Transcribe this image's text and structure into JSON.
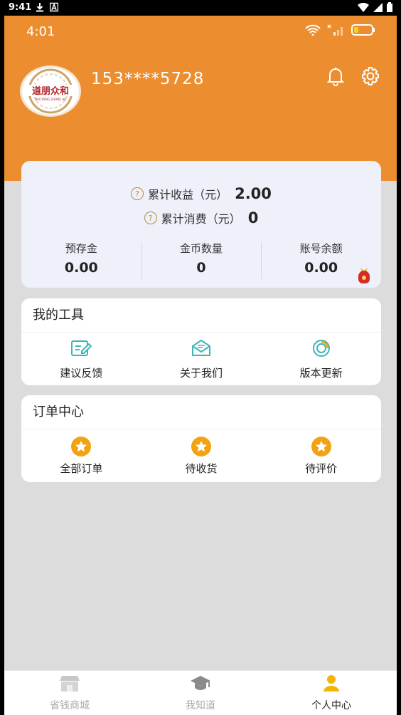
{
  "system": {
    "time": "9:41"
  },
  "inner_status": {
    "time": "4:01"
  },
  "profile": {
    "phone": "153****5728",
    "avatar_text": "道朋众和",
    "avatar_subtext": "DAO PENG ZHONG HE"
  },
  "stats": {
    "earnings_label": "累计收益（元）",
    "earnings_value": "2.00",
    "spending_label": "累计消费（元）",
    "spending_value": "0",
    "columns": [
      {
        "label": "预存金",
        "value": "0.00"
      },
      {
        "label": "金币数量",
        "value": "0"
      },
      {
        "label": "账号余额",
        "value": "0.00"
      }
    ]
  },
  "tools": {
    "title": "我的工具",
    "items": [
      {
        "label": "建议反馈",
        "icon": "edit-icon"
      },
      {
        "label": "关于我们",
        "icon": "mail-icon"
      },
      {
        "label": "版本更新",
        "icon": "update-icon"
      }
    ]
  },
  "orders": {
    "title": "订单中心",
    "items": [
      {
        "label": "全部订单",
        "icon": "star-icon"
      },
      {
        "label": "待收货",
        "icon": "star-icon"
      },
      {
        "label": "待评价",
        "icon": "star-icon"
      }
    ]
  },
  "tabs": [
    {
      "label": "省钱商城",
      "icon": "shop-icon",
      "active": false
    },
    {
      "label": "我知道",
      "icon": "graduation-cap-icon",
      "active": false
    },
    {
      "label": "个人中心",
      "icon": "user-icon",
      "active": true
    }
  ],
  "colors": {
    "accent": "#ec8e30",
    "star": "#f2a215",
    "teal": "#3bb5b8",
    "tab_active": "#f5b400"
  }
}
